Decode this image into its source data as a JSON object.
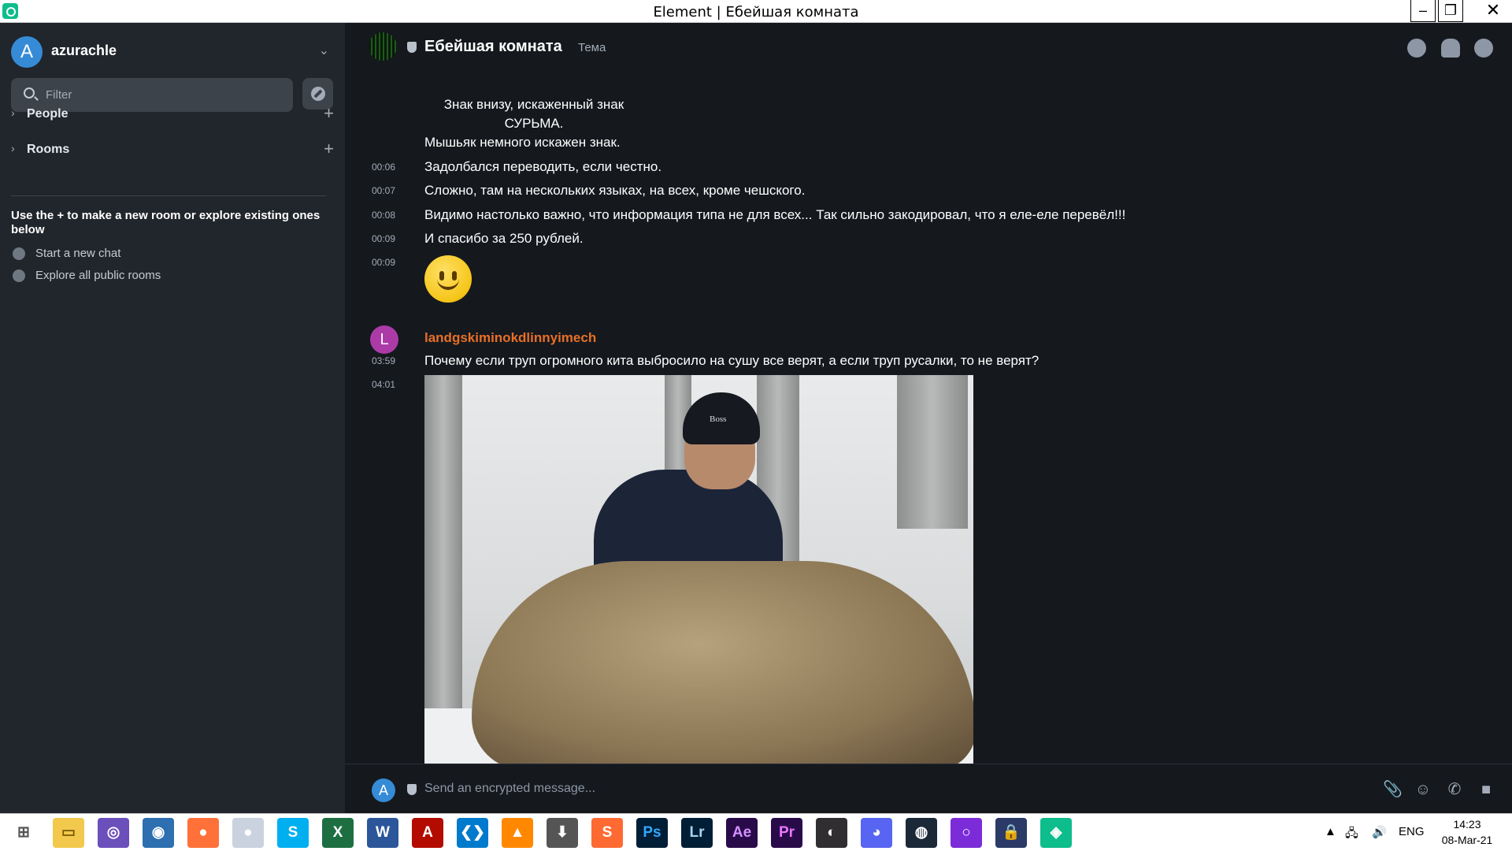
{
  "window": {
    "title": "Element | Ебейшая комната",
    "minimize": "–",
    "maximize": "❐",
    "close": "✕"
  },
  "sidebar": {
    "user": {
      "avatar_letter": "A",
      "name": "azurachle",
      "chevron": "⌄"
    },
    "filter": {
      "placeholder": "Filter"
    },
    "sections": [
      {
        "label": "People",
        "chevron": "›",
        "add": "+"
      },
      {
        "label": "Rooms",
        "chevron": "›",
        "add": "+"
      }
    ],
    "hint": "Use the + to make a new room or explore existing ones below",
    "links": [
      {
        "label": "Start a new chat",
        "icon": "chat-bubble-icon"
      },
      {
        "label": "Explore all public rooms",
        "icon": "compass-icon"
      }
    ]
  },
  "room": {
    "name": "Ебейшая комната",
    "topic": "Тема",
    "icons": [
      "search-icon",
      "bell-icon",
      "info-icon"
    ]
  },
  "timeline": {
    "center_lines": [
      "Знак внизу, искаженный знак",
      "СУРЬМА."
    ],
    "messages": [
      {
        "time": "",
        "text": "Мышьяк немного искажен знак."
      },
      {
        "time": "00:06",
        "text": "Задолбался переводить, если честно."
      },
      {
        "time": "00:07",
        "text": "Сложно, там на нескольких языках, на всех, кроме чешского."
      },
      {
        "time": "00:08",
        "text": "Видимо настолько важно, что информация типа не для всех... Так сильно закодировал, что я еле-еле перевёл!!!"
      },
      {
        "time": "00:09",
        "text": "И спасибо за 250 рублей."
      }
    ],
    "emoji_time": "00:09",
    "sender": {
      "avatar_letter": "L",
      "name": "landgskiminokdlinnyimech",
      "color": "#e86f27"
    },
    "sender_message": {
      "time": "03:59",
      "text": "Почему если труп огромного кита выбросило на сушу все верят, а если труп русалки, то не верят?"
    },
    "image_time": "04:01",
    "hat_text": "Boss",
    "jump_icon": "⌄"
  },
  "composer": {
    "avatar_letter": "A",
    "placeholder": "Send an encrypted message...",
    "icons": [
      "paperclip-icon",
      "emoji-icon",
      "phone-icon",
      "video-icon"
    ],
    "glyphs": [
      "📎",
      "☺",
      "✆",
      "■"
    ]
  },
  "taskbar": {
    "apps": [
      {
        "name": "windows-start-icon",
        "label": "⊞",
        "bg": "#ffffff",
        "fg": "#555"
      },
      {
        "name": "file-explorer-icon",
        "label": "▭",
        "bg": "#f2c94c",
        "fg": "#7a5a00"
      },
      {
        "name": "torrent-icon",
        "label": "◎",
        "bg": "#6b4fbb",
        "fg": "#fff"
      },
      {
        "name": "browser-globe-icon",
        "label": "◉",
        "bg": "#2d6fb0",
        "fg": "#fff"
      },
      {
        "name": "firefox-icon",
        "label": "●",
        "bg": "#ff7139",
        "fg": "#fff"
      },
      {
        "name": "moon-app-icon",
        "label": "●",
        "bg": "#c9d2de",
        "fg": "#fff"
      },
      {
        "name": "skype-icon",
        "label": "S",
        "bg": "#00aff0",
        "fg": "#fff"
      },
      {
        "name": "excel-icon",
        "label": "X",
        "bg": "#1d6f42",
        "fg": "#fff"
      },
      {
        "name": "word-icon",
        "label": "W",
        "bg": "#2b579a",
        "fg": "#fff"
      },
      {
        "name": "acrobat-icon",
        "label": "A",
        "bg": "#b30b00",
        "fg": "#fff"
      },
      {
        "name": "vscode-icon",
        "label": "❮❯",
        "bg": "#007acc",
        "fg": "#fff"
      },
      {
        "name": "vlc-icon",
        "label": "▲",
        "bg": "#ff8800",
        "fg": "#fff"
      },
      {
        "name": "download-icon",
        "label": "⬇",
        "bg": "#555555",
        "fg": "#fff"
      },
      {
        "name": "sublime-icon",
        "label": "S",
        "bg": "#ff6a33",
        "fg": "#fff"
      },
      {
        "name": "photoshop-icon",
        "label": "Ps",
        "bg": "#001e36",
        "fg": "#31a8ff"
      },
      {
        "name": "lightroom-icon",
        "label": "Lr",
        "bg": "#001e36",
        "fg": "#a7d6f0"
      },
      {
        "name": "after-effects-icon",
        "label": "Ae",
        "bg": "#2a0b4a",
        "fg": "#d291ff"
      },
      {
        "name": "premiere-icon",
        "label": "Pr",
        "bg": "#2a0b4a",
        "fg": "#ea77ff"
      },
      {
        "name": "obs-icon",
        "label": "◐",
        "bg": "#302e31",
        "fg": "#fff"
      },
      {
        "name": "discord-icon",
        "label": "◕",
        "bg": "#5865f2",
        "fg": "#fff"
      },
      {
        "name": "steam-icon",
        "label": "◍",
        "bg": "#1b2838",
        "fg": "#fff"
      },
      {
        "name": "cortana-icon",
        "label": "○",
        "bg": "#7b2cd8",
        "fg": "#fff"
      },
      {
        "name": "lock-app-icon",
        "label": "🔒",
        "bg": "#2b3a67",
        "fg": "#fff"
      },
      {
        "name": "element-app-icon",
        "label": "◈",
        "bg": "#0dbd8b",
        "fg": "#fff"
      }
    ],
    "tray_arrow": "▲",
    "network_icon": "🖧",
    "volume_icon": "🔊",
    "language": "ENG",
    "time": "14:23",
    "date": "08-Mar-21"
  }
}
